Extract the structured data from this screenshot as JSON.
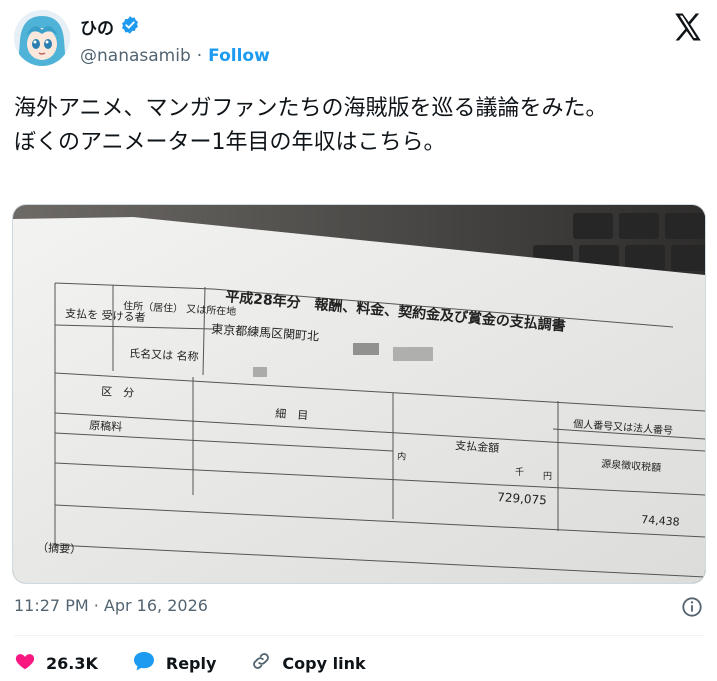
{
  "user": {
    "display_name": "ひの",
    "handle": "@nanasamib",
    "separator": "·",
    "follow_label": "Follow"
  },
  "tweet": {
    "text": "海外アニメ、マンガファンたちの海賊版を巡る議論をみた。\nぼくのアニメーター1年目の年収はこちら。"
  },
  "media": {
    "doc_title": "平成28年分　報酬、料金、契約金及び賞金の支払調書",
    "payer_label": "支払を\n受ける者",
    "address_label": "住所（居住）\n又は所在地",
    "address_value": "東京都練馬区関町北",
    "name_label": "氏名又は\n名称",
    "category_label": "区　分",
    "details_label": "細　目",
    "id_label": "個人番号又は法人番号",
    "category_value": "原稿料",
    "payment_label": "支払金額",
    "withholding_label": "源泉徴収税額",
    "inner_label": "内",
    "thousand_label": "千",
    "yen_label": "円",
    "payment_value": "729,075",
    "withholding_value": "74,438",
    "remarks_label": "（摘要）"
  },
  "footer": {
    "timestamp": "11:27 PM · Apr 16, 2026",
    "likes": "26.3K",
    "reply_label": "Reply",
    "copy_label": "Copy link"
  },
  "colors": {
    "accent": "#1d9bf0",
    "like": "#f91880",
    "secondary_text": "#536471"
  }
}
